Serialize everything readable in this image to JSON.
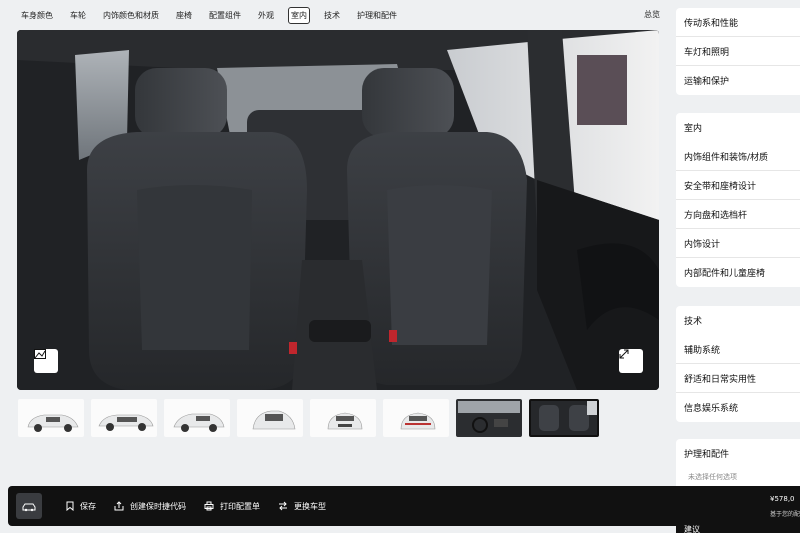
{
  "nav": {
    "tabs": [
      {
        "label": "车身颜色"
      },
      {
        "label": "车轮"
      },
      {
        "label": "内饰颜色和材质"
      },
      {
        "label": "座椅"
      },
      {
        "label": "配置组件"
      },
      {
        "label": "外观"
      },
      {
        "label": "室内"
      },
      {
        "label": "技术"
      },
      {
        "label": "护理和配件"
      }
    ],
    "active_tab": "室内",
    "overview": "总览"
  },
  "viewer": {
    "scene": "interior-front-seats",
    "left_button_icon": "image-icon",
    "right_button_icon": "expand-icon"
  },
  "thumbnails": [
    {
      "view": "exterior-front-quarter",
      "selected": false
    },
    {
      "view": "exterior-side",
      "selected": false
    },
    {
      "view": "exterior-rear-quarter",
      "selected": false
    },
    {
      "view": "exterior-rear-top",
      "selected": false
    },
    {
      "view": "exterior-front",
      "selected": false
    },
    {
      "view": "exterior-rear",
      "selected": false
    },
    {
      "view": "interior-dashboard",
      "selected": false
    },
    {
      "view": "interior-seats",
      "selected": true
    }
  ],
  "sidebar": {
    "group1": [
      "传动系和性能",
      "车灯和照明",
      "运输和保护"
    ],
    "group2": [
      "室内",
      "内饰组件和装饰/材质",
      "安全带和座椅设计",
      "方向盘和选档杆",
      "内饰设计",
      "内部配件和儿童座椅"
    ],
    "group3": [
      "技术",
      "辅助系统",
      "舒适和日常实用性",
      "信息娱乐系统"
    ],
    "group4_title": "护理和配件",
    "group4_note": "未选择任何选项",
    "suggest_label": "建议"
  },
  "bottombar": {
    "car_icon": "car-icon",
    "actions": [
      {
        "label": "保存",
        "icon": "bookmark-icon"
      },
      {
        "label": "创建保时捷代码",
        "icon": "share-icon"
      },
      {
        "label": "打印配置单",
        "icon": "printer-icon"
      },
      {
        "label": "更换车型",
        "icon": "swap-icon"
      }
    ],
    "price": "¥578,0",
    "price_note": "基于您的配"
  },
  "colors": {
    "page_bg": "#eef0f2",
    "bar_bg": "#111111",
    "card_bg": "#ffffff"
  }
}
